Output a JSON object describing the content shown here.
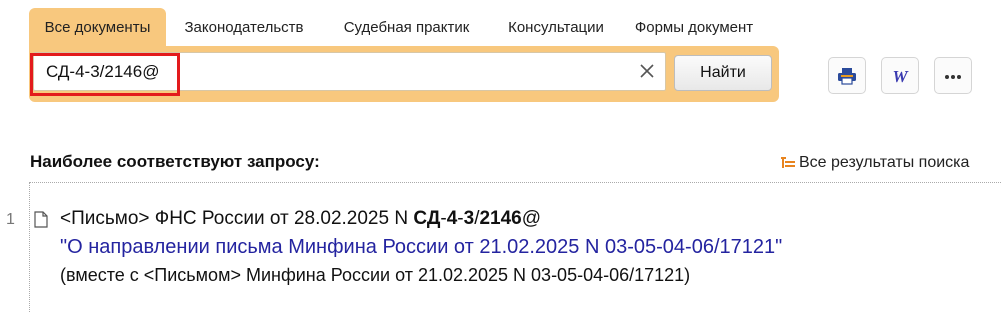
{
  "tabs": [
    {
      "label": "Все документы",
      "active": true
    },
    {
      "label": "Законодательств",
      "active": false
    },
    {
      "label": "Судебная практик",
      "active": false
    },
    {
      "label": "Консультации",
      "active": false
    },
    {
      "label": "Формы документ",
      "active": false
    }
  ],
  "search": {
    "value": "СД-4-3/2146@",
    "button_label": "Найти"
  },
  "toolbar": {
    "print_icon": "printer-icon",
    "word_icon": "word-export-icon",
    "more_icon": "more-dots-icon"
  },
  "results": {
    "heading": "Наиболее соответствуют запросу:",
    "all_results_label": "Все результаты поиска",
    "items": [
      {
        "number": "1",
        "line1_prefix": "<Письмо> ФНС России от 28.02.2025 N ",
        "line1_parts": [
          "СД",
          "-",
          "4",
          "-",
          "3",
          "/",
          "2146",
          "@"
        ],
        "title": "\"О направлении письма Минфина России от 21.02.2025 N 03-05-04-06/17121\"",
        "line3": "(вместе с <Письмом> Минфина России от 21.02.2025 N 03-05-04-06/17121)"
      }
    ]
  },
  "colors": {
    "accent": "#f8c87e",
    "link": "#2424a0",
    "highlight": "#e31a1c"
  }
}
